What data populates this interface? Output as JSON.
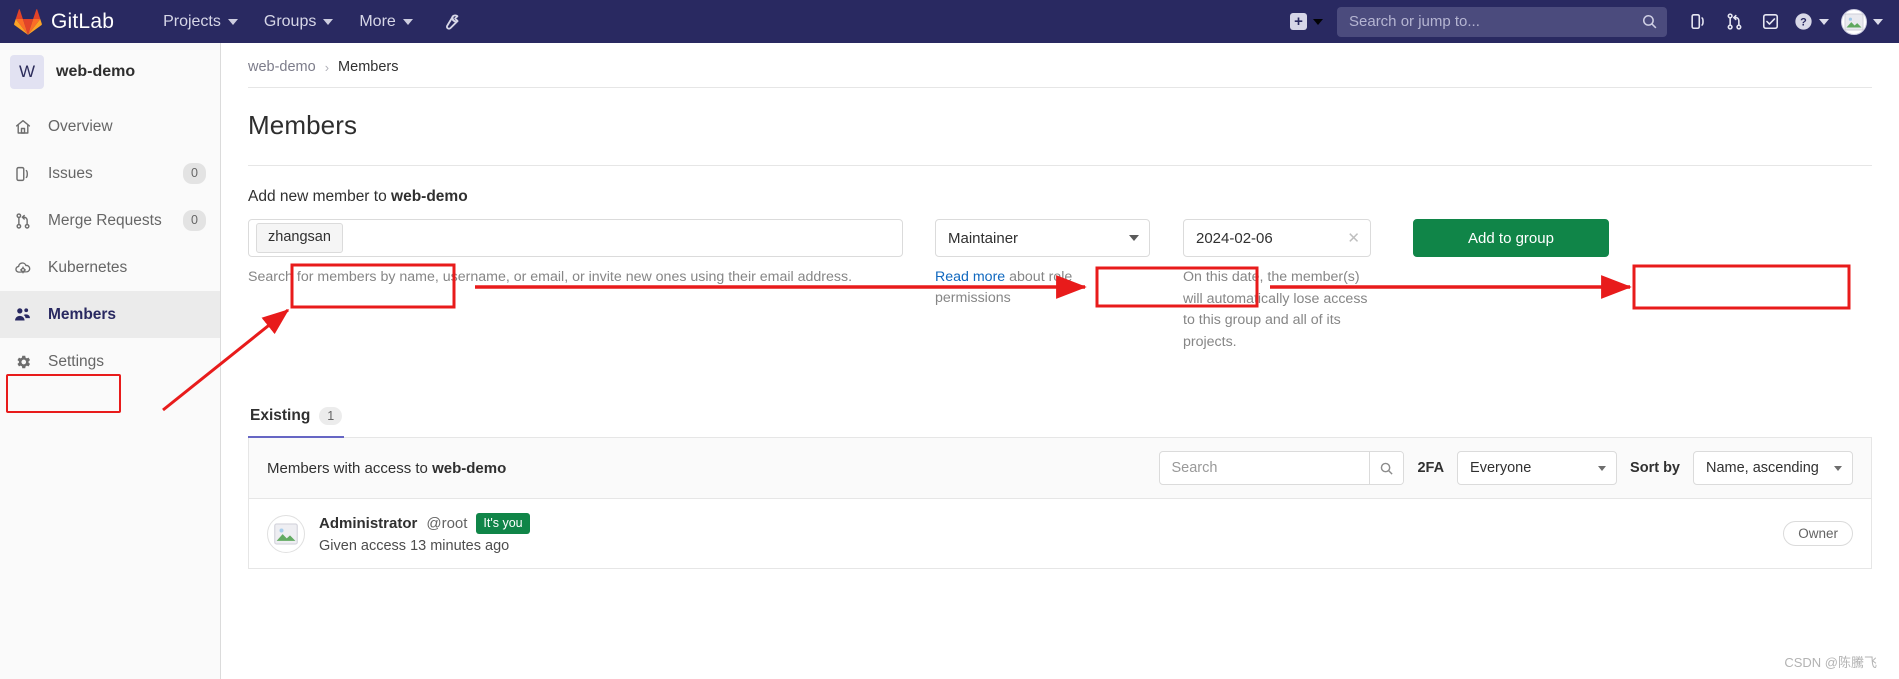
{
  "navbar": {
    "brand": "GitLab",
    "links": [
      {
        "label": "Projects",
        "name": "nav-projects"
      },
      {
        "label": "Groups",
        "name": "nav-groups"
      },
      {
        "label": "More",
        "name": "nav-more"
      }
    ],
    "search_placeholder": "Search or jump to...",
    "search_value": "",
    "icons": {
      "wrench": "wrench-icon",
      "plus": "plus-icon",
      "issues": "issues-icon",
      "merge_requests": "merge-requests-icon",
      "todos": "todos-icon",
      "help": "help-icon",
      "avatar": "user-avatar"
    }
  },
  "sidebar": {
    "project_initial": "W",
    "project_name": "web-demo",
    "items": [
      {
        "label": "Overview",
        "count": "",
        "icon": "home-icon",
        "active": false
      },
      {
        "label": "Issues",
        "count": "0",
        "icon": "issues-icon",
        "active": false
      },
      {
        "label": "Merge Requests",
        "count": "0",
        "icon": "merge-requests-icon",
        "active": false
      },
      {
        "label": "Kubernetes",
        "count": "",
        "icon": "kubernetes-icon",
        "active": false
      },
      {
        "label": "Members",
        "count": "",
        "icon": "members-icon",
        "active": true
      },
      {
        "label": "Settings",
        "count": "",
        "icon": "gear-icon",
        "active": false
      }
    ]
  },
  "breadcrumb": {
    "root": "web-demo",
    "separator": "›",
    "current": "Members"
  },
  "page": {
    "title": "Members"
  },
  "add_member": {
    "label_prefix": "Add new member to ",
    "label_group": "web-demo",
    "search": {
      "token": "zhangsan",
      "placeholder": "Search for members",
      "help": "Search for members by name, username, or email, or invite new ones using their email address."
    },
    "role": {
      "value": "Maintainer",
      "help_link": "Read more",
      "help_rest": " about role permissions"
    },
    "expires": {
      "value": "2024-02-06",
      "clear_icon": "clear-icon",
      "help": "On this date, the member(s) will automatically lose access to this group and all of its projects."
    },
    "submit_label": "Add to group"
  },
  "tabs": [
    {
      "label": "Existing",
      "count": "1",
      "active": true
    }
  ],
  "members_panel": {
    "title_prefix": "Members with access to ",
    "title_group": "web-demo",
    "search_placeholder": "Search",
    "search_value": "",
    "twofa_label": "2FA",
    "twofa_value": "Everyone",
    "sort_label": "Sort by",
    "sort_value": "Name, ascending",
    "rows": [
      {
        "name": "Administrator",
        "handle": "@root",
        "badge": "It's you",
        "sub": "Given access 13 minutes ago",
        "role": "Owner"
      }
    ]
  },
  "watermark": "CSDN @陈騰飞",
  "colors": {
    "navbar": "#292961",
    "accent_green": "#108548",
    "annotation_red": "#e81b1b",
    "link_blue": "#1068bf",
    "tab_underline": "#6666c4"
  }
}
